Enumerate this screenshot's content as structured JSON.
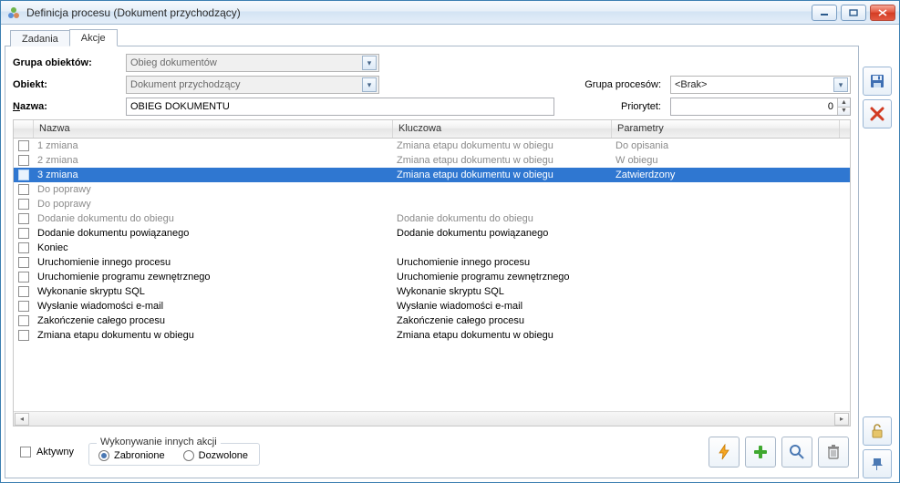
{
  "window": {
    "title": "Definicja procesu (Dokument przychodzący)"
  },
  "tabs": {
    "zadania": "Zadania",
    "akcje": "Akcje",
    "active": "akcje"
  },
  "labels": {
    "grupa_obiektow": "Grupa obiektów:",
    "obiekt": "Obiekt:",
    "nazwa": "Nazwa:",
    "grupa_procesow": "Grupa procesów:",
    "priorytet": "Priorytet:"
  },
  "form": {
    "grupa_obiektow": "Obieg dokumentów",
    "obiekt": "Dokument przychodzący",
    "nazwa": "OBIEG DOKUMENTU",
    "grupa_procesow": "<Brak>",
    "priorytet": "0"
  },
  "table": {
    "headers": {
      "nazwa": "Nazwa",
      "kluczowa": "Kluczowa",
      "parametry": "Parametry"
    },
    "rows": [
      {
        "dim": true,
        "sel": false,
        "nazwa": "1 zmiana",
        "kluczowa": "Zmiana etapu dokumentu w obiegu",
        "parametry": "Do opisania"
      },
      {
        "dim": true,
        "sel": false,
        "nazwa": "2 zmiana",
        "kluczowa": "Zmiana etapu dokumentu w obiegu",
        "parametry": "W obiegu"
      },
      {
        "dim": false,
        "sel": true,
        "nazwa": "3 zmiana",
        "kluczowa": "Zmiana etapu dokumentu w obiegu",
        "parametry": "Zatwierdzony"
      },
      {
        "dim": true,
        "sel": false,
        "nazwa": "Do poprawy",
        "kluczowa": "",
        "parametry": ""
      },
      {
        "dim": true,
        "sel": false,
        "nazwa": "Do poprawy",
        "kluczowa": "",
        "parametry": ""
      },
      {
        "dim": true,
        "sel": false,
        "nazwa": "Dodanie dokumentu do obiegu",
        "kluczowa": "Dodanie dokumentu do obiegu",
        "parametry": ""
      },
      {
        "dim": false,
        "sel": false,
        "nazwa": "Dodanie dokumentu powiązanego",
        "kluczowa": "Dodanie dokumentu powiązanego",
        "parametry": ""
      },
      {
        "dim": false,
        "sel": false,
        "nazwa": "Koniec",
        "kluczowa": "",
        "parametry": ""
      },
      {
        "dim": false,
        "sel": false,
        "nazwa": "Uruchomienie innego procesu",
        "kluczowa": "Uruchomienie innego procesu",
        "parametry": ""
      },
      {
        "dim": false,
        "sel": false,
        "nazwa": "Uruchomienie programu zewnętrznego",
        "kluczowa": "Uruchomienie programu zewnętrznego",
        "parametry": ""
      },
      {
        "dim": false,
        "sel": false,
        "nazwa": "Wykonanie skryptu SQL",
        "kluczowa": "Wykonanie skryptu SQL",
        "parametry": ""
      },
      {
        "dim": false,
        "sel": false,
        "nazwa": "Wysłanie wiadomości e-mail",
        "kluczowa": "Wysłanie wiadomości e-mail",
        "parametry": ""
      },
      {
        "dim": false,
        "sel": false,
        "nazwa": "Zakończenie całego procesu",
        "kluczowa": "Zakończenie całego procesu",
        "parametry": ""
      },
      {
        "dim": false,
        "sel": false,
        "nazwa": "Zmiana etapu dokumentu w obiegu",
        "kluczowa": "Zmiana etapu dokumentu w obiegu",
        "parametry": ""
      }
    ]
  },
  "bottom": {
    "aktywny": "Aktywny",
    "grp_legend": "Wykonywanie innych akcji",
    "zabronione": "Zabronione",
    "dozwolone": "Dozwolone",
    "selected_radio": "zabronione"
  },
  "col_widths": {
    "c1": 394,
    "c2": 240,
    "c3": 250
  }
}
